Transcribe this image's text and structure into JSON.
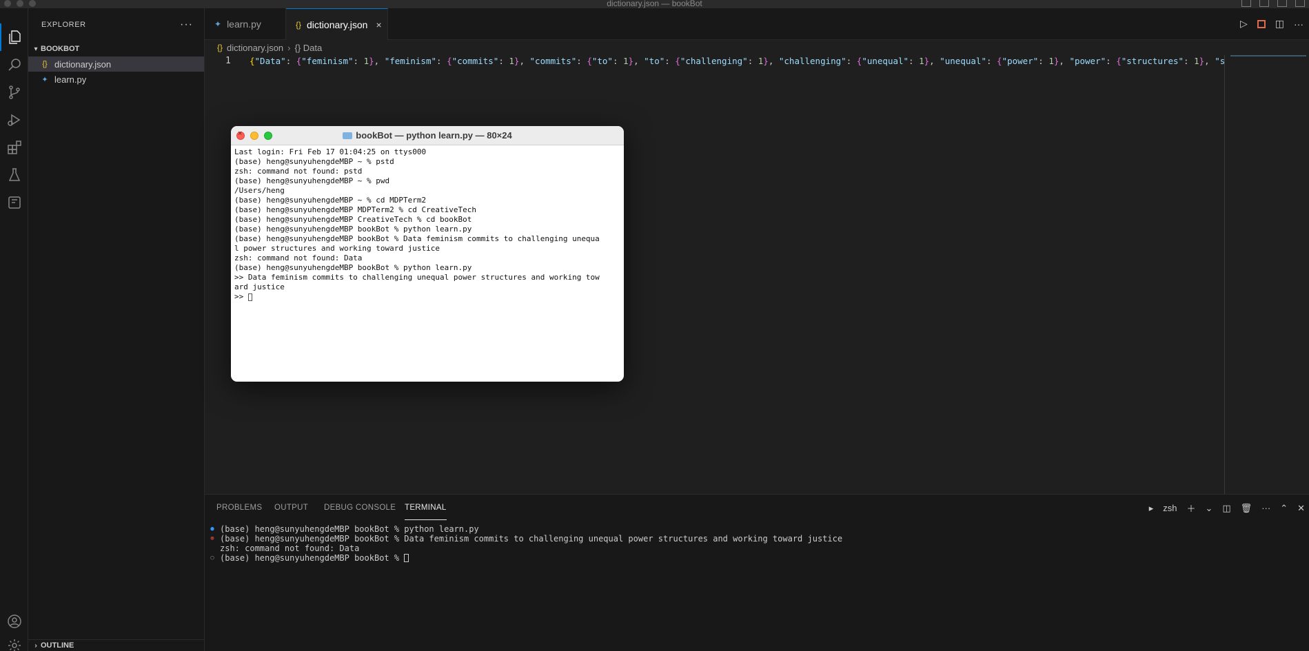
{
  "window": {
    "title": "dictionary.json — bookBot"
  },
  "sidebar": {
    "title": "EXPLORER",
    "more": "···",
    "project": "BOOKBOT",
    "files": [
      {
        "name": "dictionary.json",
        "icon": "{}"
      },
      {
        "name": "learn.py",
        "icon": "✦"
      }
    ],
    "outline": "OUTLINE"
  },
  "tabs": [
    {
      "label": "learn.py",
      "icon": "✦"
    },
    {
      "label": "dictionary.json",
      "icon": "{}",
      "close": "×"
    }
  ],
  "breadcrumb": {
    "file": "dictionary.json",
    "sep": "›",
    "symbol": "{} Data"
  },
  "editor": {
    "line_number": "1",
    "code_segments": [
      {
        "t": "{",
        "c": "b1"
      },
      {
        "t": "\"Data\"",
        "c": "k"
      },
      {
        "t": ": ",
        "c": ""
      },
      {
        "t": "{",
        "c": "b2"
      },
      {
        "t": "\"feminism\"",
        "c": "k"
      },
      {
        "t": ": ",
        "c": ""
      },
      {
        "t": "1",
        "c": "n"
      },
      {
        "t": "}",
        "c": "b2"
      },
      {
        "t": ", ",
        "c": ""
      },
      {
        "t": "\"feminism\"",
        "c": "k"
      },
      {
        "t": ": ",
        "c": ""
      },
      {
        "t": "{",
        "c": "b2"
      },
      {
        "t": "\"commits\"",
        "c": "k"
      },
      {
        "t": ": ",
        "c": ""
      },
      {
        "t": "1",
        "c": "n"
      },
      {
        "t": "}",
        "c": "b2"
      },
      {
        "t": ", ",
        "c": ""
      },
      {
        "t": "\"commits\"",
        "c": "k"
      },
      {
        "t": ": ",
        "c": ""
      },
      {
        "t": "{",
        "c": "b2"
      },
      {
        "t": "\"to\"",
        "c": "k"
      },
      {
        "t": ": ",
        "c": ""
      },
      {
        "t": "1",
        "c": "n"
      },
      {
        "t": "}",
        "c": "b2"
      },
      {
        "t": ", ",
        "c": ""
      },
      {
        "t": "\"to\"",
        "c": "k"
      },
      {
        "t": ": ",
        "c": ""
      },
      {
        "t": "{",
        "c": "b2"
      },
      {
        "t": "\"challenging\"",
        "c": "k"
      },
      {
        "t": ": ",
        "c": ""
      },
      {
        "t": "1",
        "c": "n"
      },
      {
        "t": "}",
        "c": "b2"
      },
      {
        "t": ", ",
        "c": ""
      },
      {
        "t": "\"challenging\"",
        "c": "k"
      },
      {
        "t": ": ",
        "c": ""
      },
      {
        "t": "{",
        "c": "b2"
      },
      {
        "t": "\"unequal\"",
        "c": "k"
      },
      {
        "t": ": ",
        "c": ""
      },
      {
        "t": "1",
        "c": "n"
      },
      {
        "t": "}",
        "c": "b2"
      },
      {
        "t": ", ",
        "c": ""
      },
      {
        "t": "\"unequal\"",
        "c": "k"
      },
      {
        "t": ": ",
        "c": ""
      },
      {
        "t": "{",
        "c": "b2"
      },
      {
        "t": "\"power\"",
        "c": "k"
      },
      {
        "t": ": ",
        "c": ""
      },
      {
        "t": "1",
        "c": "n"
      },
      {
        "t": "}",
        "c": "b2"
      },
      {
        "t": ", ",
        "c": ""
      },
      {
        "t": "\"power\"",
        "c": "k"
      },
      {
        "t": ": ",
        "c": ""
      },
      {
        "t": "{",
        "c": "b2"
      },
      {
        "t": "\"structures\"",
        "c": "k"
      },
      {
        "t": ": ",
        "c": ""
      },
      {
        "t": "1",
        "c": "n"
      },
      {
        "t": "}",
        "c": "b2"
      },
      {
        "t": ", ",
        "c": ""
      },
      {
        "t": "\"structure",
        "c": "k"
      }
    ]
  },
  "panel": {
    "tabs": [
      "PROBLEMS",
      "OUTPUT",
      "DEBUG CONSOLE",
      "TERMINAL"
    ],
    "active_tab": "TERMINAL",
    "shell": "zsh",
    "terminal_lines": [
      {
        "status": "blue",
        "text": "(base) heng@sunyuhengdeMBP bookBot % python learn.py"
      },
      {
        "status": "red",
        "text": "(base) heng@sunyuhengdeMBP bookBot % Data feminism commits to challenging unequal power structures and working toward justice"
      },
      {
        "status": "none",
        "text": "zsh: command not found: Data"
      },
      {
        "status": "gray",
        "text": "(base) heng@sunyuhengdeMBP bookBot % "
      }
    ]
  },
  "mac_terminal": {
    "title": "bookBot — python learn.py — 80×24",
    "lines": [
      "Last login: Fri Feb 17 01:04:25 on ttys000",
      "(base) heng@sunyuhengdeMBP ~ % pstd",
      "zsh: command not found: pstd",
      "(base) heng@sunyuhengdeMBP ~ % pwd",
      "/Users/heng",
      "(base) heng@sunyuhengdeMBP ~ % cd MDPTerm2",
      "(base) heng@sunyuhengdeMBP MDPTerm2 % cd CreativeTech",
      "(base) heng@sunyuhengdeMBP CreativeTech % cd bookBot",
      "(base) heng@sunyuhengdeMBP bookBot % python learn.py",
      "(base) heng@sunyuhengdeMBP bookBot % Data feminism commits to challenging unequa",
      "l power structures and working toward justice",
      "zsh: command not found: Data",
      "(base) heng@sunyuhengdeMBP bookBot % python learn.py",
      ">> Data feminism commits to challenging unequal power structures and working tow",
      "ard justice",
      ">> "
    ]
  },
  "colors": {
    "accent": "#0078d4",
    "json_icon": "#e8c73b",
    "py_icon": "#5fa3d6"
  }
}
